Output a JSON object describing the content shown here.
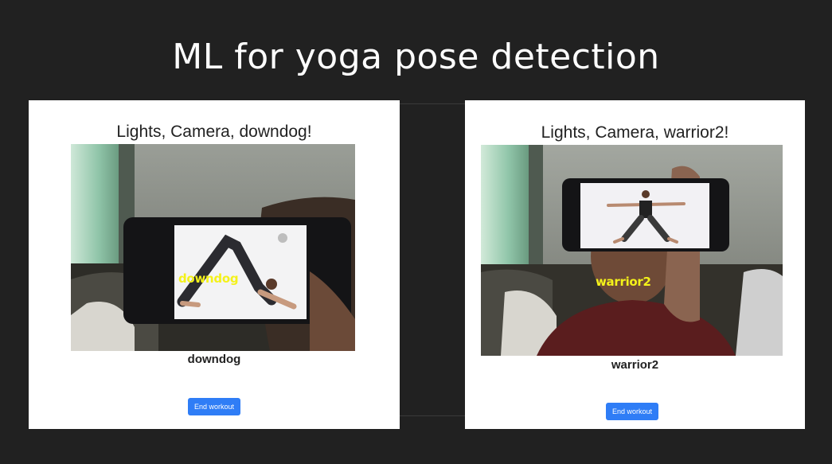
{
  "slide": {
    "title": "ML for yoga pose detection"
  },
  "panels": [
    {
      "heading": "Lights, Camera, downdog!",
      "overlay_label": "downdog",
      "pose_label": "downdog",
      "button_label": "End workout"
    },
    {
      "heading": "Lights, Camera, warrior2!",
      "overlay_label": "warrior2",
      "pose_label": "warrior2",
      "button_label": "End workout"
    }
  ],
  "colors": {
    "background": "#212121",
    "panel": "#ffffff",
    "button": "#2f7df6",
    "overlay_text": "#f4f21a"
  }
}
